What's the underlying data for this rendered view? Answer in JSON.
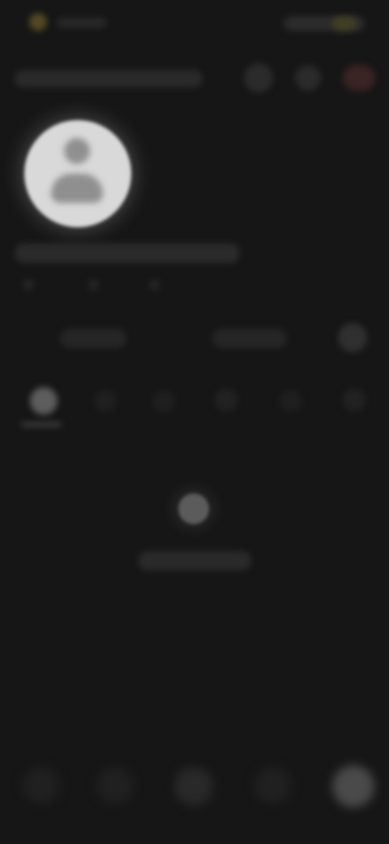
{
  "screen": {
    "title": "",
    "status": {
      "left_indicator": "status-dot",
      "right_indicator": "status-pill"
    }
  },
  "toolbar": {
    "username": "",
    "buttons": [
      {
        "name": "action-icon-1"
      },
      {
        "name": "action-icon-2"
      },
      {
        "name": "action-icon-3"
      }
    ]
  },
  "profile": {
    "avatar": "avatar",
    "name": "",
    "stats": [
      "",
      "",
      ""
    ]
  },
  "actions": [
    {
      "label": ""
    },
    {
      "label": ""
    },
    {
      "icon": "more-icon"
    }
  ],
  "tabs": [
    {
      "icon": "grid-icon"
    },
    {
      "icon": "tab-icon-2"
    },
    {
      "icon": "tab-icon-3"
    },
    {
      "icon": "tab-icon-4"
    },
    {
      "icon": "tab-icon-5"
    },
    {
      "icon": "tab-icon-6"
    }
  ],
  "empty_state": {
    "icon": "empty-icon",
    "label": ""
  },
  "bottom_nav": [
    {
      "icon": "home-icon"
    },
    {
      "icon": "search-icon"
    },
    {
      "icon": "center-icon"
    },
    {
      "icon": "message-icon"
    },
    {
      "icon": "profile-icon"
    }
  ]
}
